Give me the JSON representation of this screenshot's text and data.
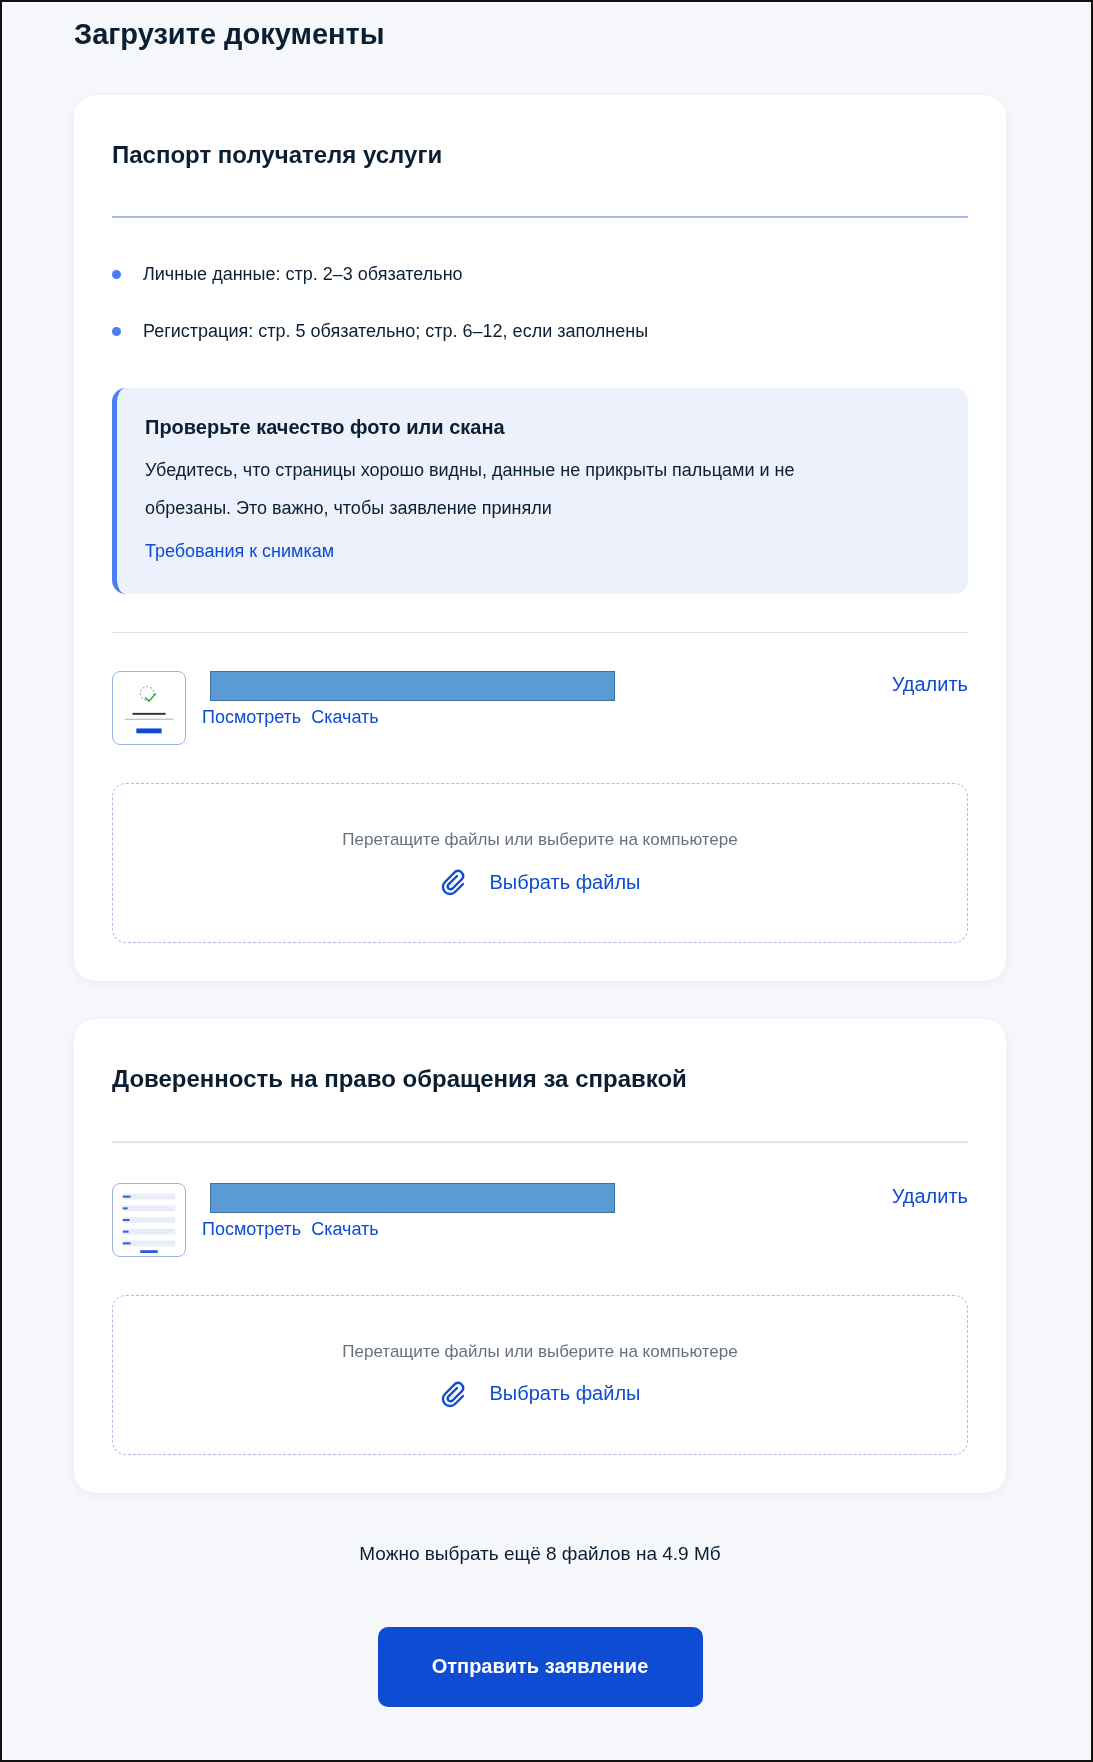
{
  "title": "Загрузите документы",
  "cards": [
    {
      "heading": "Паспорт получателя услуги",
      "bullets": [
        "Личные данные: стр. 2–3 обязательно",
        "Регистрация: стр. 5 обязательно; стр. 6–12, если заполнены"
      ],
      "notice": {
        "title": "Проверьте качество фото или скана",
        "text": "Убедитесь, что страницы хорошо видны, данные не прикрыты пальцами и не обрезаны. Это важно, чтобы заявление приняли",
        "link": "Требования к снимкам"
      },
      "files": [
        {
          "kind": "scan",
          "redacted": true,
          "view": "Посмотреть",
          "download": "Скачать",
          "delete": "Удалить"
        }
      ],
      "dropzone": {
        "hint": "Перетащите файлы или выберите на компьютере",
        "button": "Выбрать файлы"
      }
    },
    {
      "heading": "Доверенность на право обращения за справкой",
      "files": [
        {
          "kind": "form",
          "redacted": true,
          "view": "Посмотреть",
          "download": "Скачать",
          "delete": "Удалить"
        }
      ],
      "dropzone": {
        "hint": "Перетащите файлы или выберите на компьютере",
        "button": "Выбрать файлы"
      }
    }
  ],
  "limit_note": "Можно выбрать ещё 8 файлов на 4.9 Мб",
  "submit": "Отправить заявление"
}
